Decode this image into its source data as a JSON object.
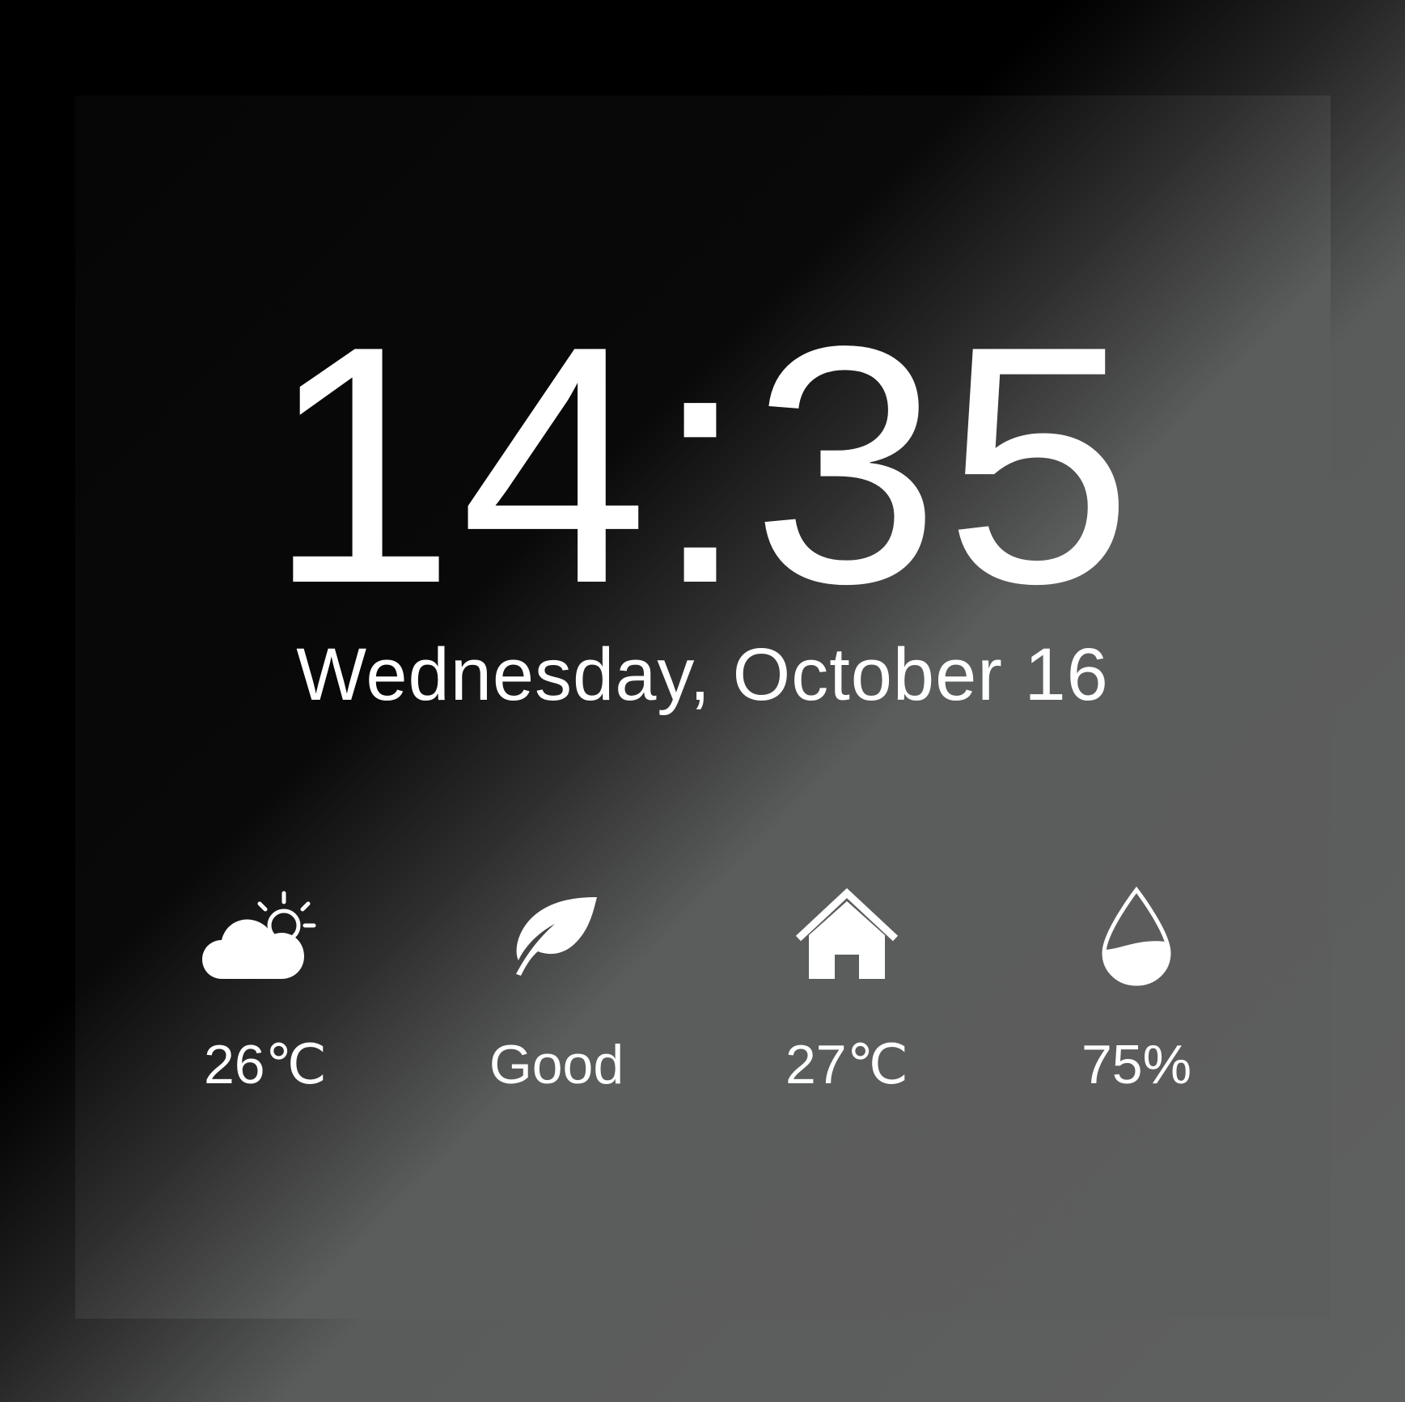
{
  "clock": {
    "time": "14:35",
    "date": "Wednesday, October 16"
  },
  "stats": [
    {
      "icon": "partly-cloudy-icon",
      "value": "26℃"
    },
    {
      "icon": "leaf-icon",
      "value": "Good"
    },
    {
      "icon": "home-icon",
      "value": "27℃"
    },
    {
      "icon": "water-drop-icon",
      "value": "75%"
    }
  ],
  "colors": {
    "text": "#ffffff",
    "background_dark": "#000000",
    "background_light": "#5c5d5d"
  }
}
